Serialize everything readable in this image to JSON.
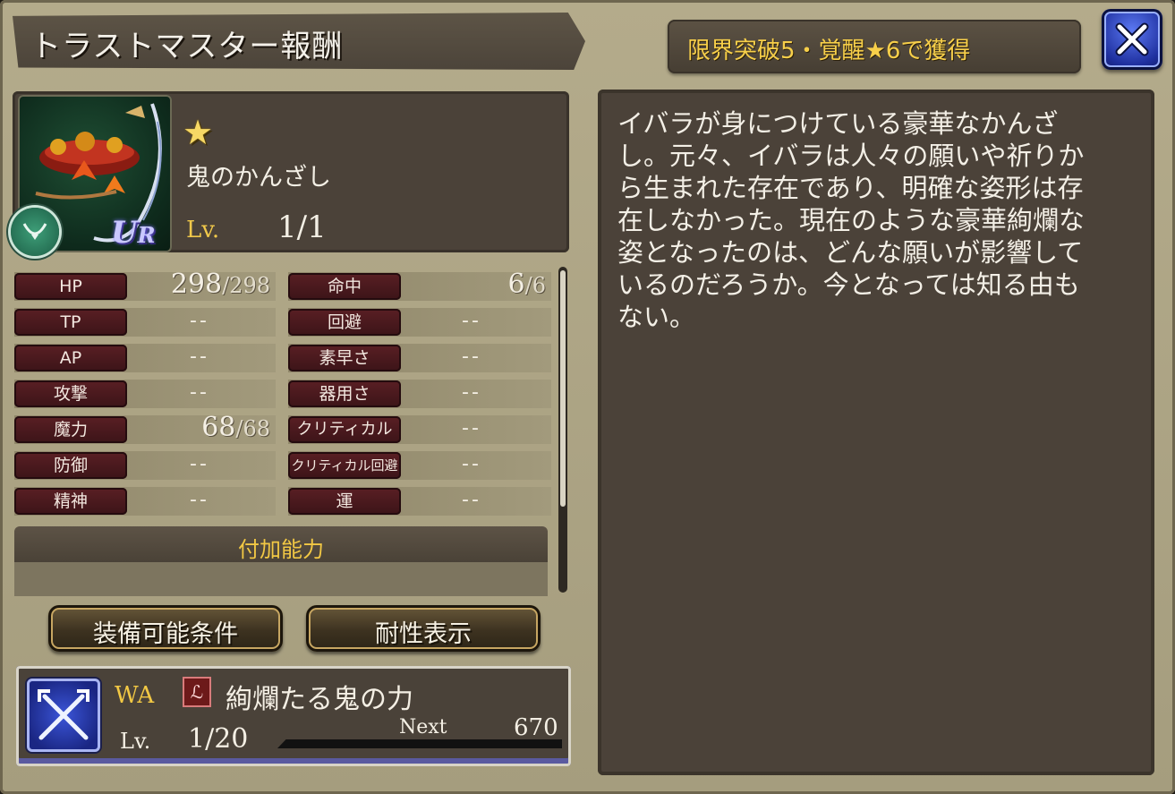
{
  "header": {
    "title": "トラストマスター報酬",
    "unlock_condition": "限界突破5・覚醒★6で獲得"
  },
  "item": {
    "rarity_star": "★",
    "rarity_badge_u": "U",
    "rarity_badge_r": "R",
    "name": "鬼のかんざし",
    "level_label": "Lv.",
    "level_value": "1/1"
  },
  "stats": {
    "left": [
      {
        "label": "HP",
        "current": "298",
        "max": "/298"
      },
      {
        "label": "TP",
        "value": "--"
      },
      {
        "label": "AP",
        "value": "--"
      },
      {
        "label": "攻撃",
        "value": "--"
      },
      {
        "label": "魔力",
        "current": "68",
        "max": "/68"
      },
      {
        "label": "防御",
        "value": "--"
      },
      {
        "label": "精神",
        "value": "--"
      }
    ],
    "right": [
      {
        "label": "命中",
        "current": "6",
        "max": "/6"
      },
      {
        "label": "回避",
        "value": "--"
      },
      {
        "label": "素早さ",
        "value": "--"
      },
      {
        "label": "器用さ",
        "value": "--"
      },
      {
        "label": "クリティカル",
        "value": "--"
      },
      {
        "label": "クリティカル回避",
        "value": "--"
      },
      {
        "label": "運",
        "value": "--"
      }
    ]
  },
  "ability": {
    "header": "付加能力"
  },
  "buttons": {
    "equip_conditions": "装備可能条件",
    "resistance": "耐性表示"
  },
  "wa": {
    "label": "WA",
    "type_glyph": "ℒ",
    "name": "絢爛たる鬼の力",
    "level_label": "Lv.",
    "level_value": "1/20",
    "next_label": "Next",
    "next_value": "670",
    "exp_progress": 0
  },
  "description": "イバラが身につけている豪華なかんざ\nし。元々、イバラは人々の願いや祈りか\nら生まれた存在であり、明確な姿形は存\n在しなかった。現在のような豪華絢爛な\n姿となったのは、どんな願いが影響して\nいるのだろうか。今となっては知る由も\nない。",
  "colors": {
    "accent_gold": "#f2c844",
    "stat_label_bg": "#4a181c",
    "close_button_blue": "#2a40c4"
  }
}
